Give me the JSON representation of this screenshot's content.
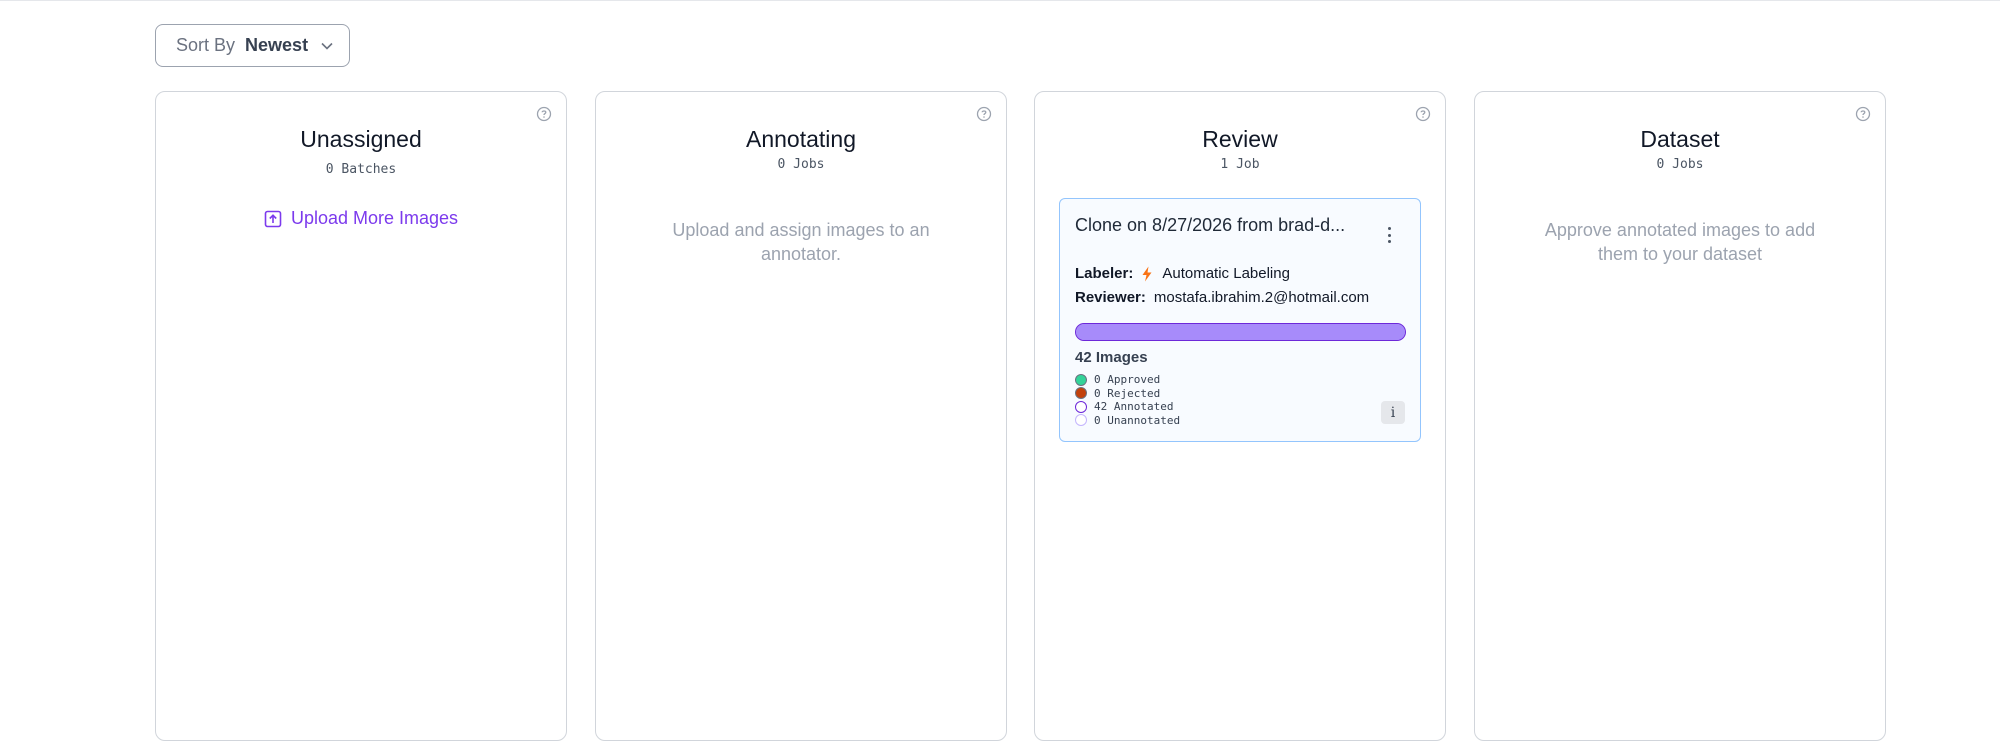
{
  "sort": {
    "label": "Sort By",
    "value": "Newest"
  },
  "columns": {
    "unassigned": {
      "title": "Unassigned",
      "count": "0 Batches",
      "action": "Upload More Images"
    },
    "annotating": {
      "title": "Annotating",
      "count": "0 Jobs",
      "message": "Upload and assign images to an annotator."
    },
    "review": {
      "title": "Review",
      "count": "1 Job",
      "job": {
        "title": "Clone on 8/27/2026 from brad-d...",
        "labeler_label": "Labeler:",
        "labeler_value": "Automatic Labeling",
        "reviewer_label": "Reviewer:",
        "reviewer_value": "mostafa.ibrahim.2@hotmail.com",
        "progress": 1.0,
        "images": "42 Images",
        "stats": [
          {
            "text": "0 Approved",
            "color": "#34d399"
          },
          {
            "text": "0 Rejected",
            "color": "#c2410c"
          },
          {
            "text": "42 Annotated",
            "color": "#ffffff"
          },
          {
            "text": "0 Unannotated",
            "color": "#ffffff"
          }
        ],
        "info_glyph": "i"
      }
    },
    "dataset": {
      "title": "Dataset",
      "count": "0 Jobs",
      "message": "Approve annotated images to add them to your dataset"
    }
  },
  "icons": {
    "help": "question-circle-icon",
    "chevron": "chevron-down-icon",
    "upload": "upload-icon",
    "bolt": "lightning-bolt-icon",
    "menu": "vertical-dots-icon"
  },
  "colors": {
    "accent": "#7c3aed",
    "progress": "#a78bfa",
    "card_border": "#93c5fd"
  }
}
